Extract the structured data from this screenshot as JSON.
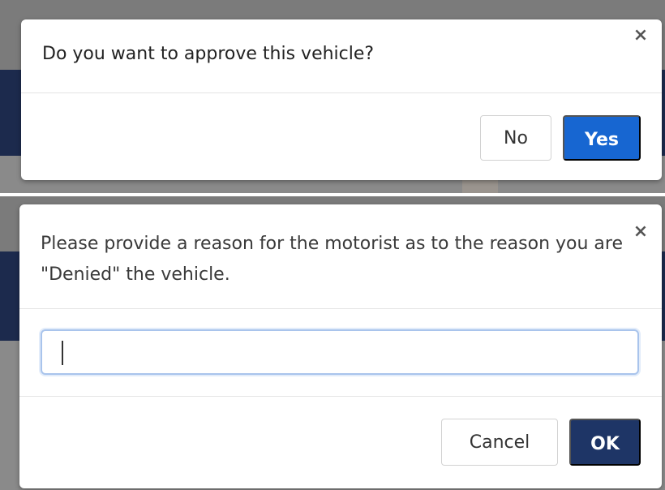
{
  "approve_dialog": {
    "title": "Do you want to approve this vehicle?",
    "close_symbol": "×",
    "no_label": "No",
    "yes_label": "Yes"
  },
  "deny_dialog": {
    "title": "Please provide a reason for the motorist as to the reason you are \"Denied\" the vehicle.",
    "close_symbol": "×",
    "reason_value": "",
    "cancel_label": "Cancel",
    "ok_label": "OK"
  },
  "colors": {
    "primary_blue": "#1766d1",
    "navy": "#1e3566",
    "overlay": "#7b7b7b",
    "header_band": "#1c2a4d"
  },
  "icons": {
    "close": "close-icon"
  }
}
